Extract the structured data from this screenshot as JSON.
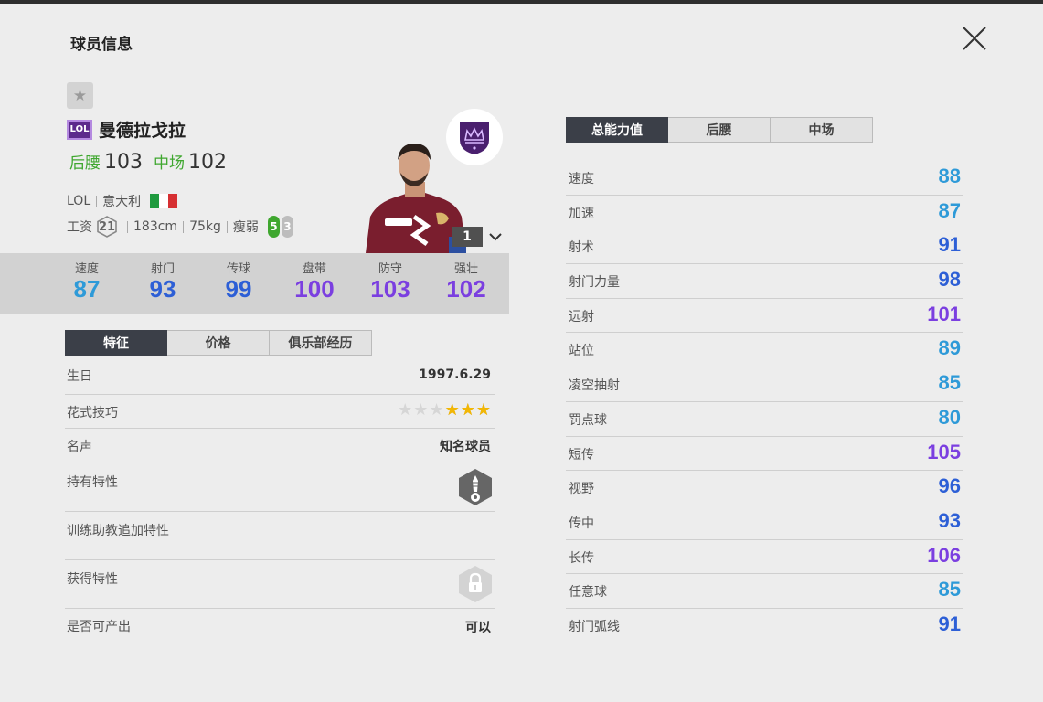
{
  "header": {
    "title": "球员信息"
  },
  "colors": {
    "green": "#3fa72f",
    "cyan": "#2e9ad8",
    "blue": "#2d5fd6",
    "purple": "#7b3fe0",
    "tabActive": "#3b3f48"
  },
  "player": {
    "season_badge": "LOL",
    "name": "曼德拉戈拉",
    "positions": [
      {
        "label": "后腰",
        "value": "103"
      },
      {
        "label": "中场",
        "value": "102"
      }
    ],
    "season": "LOL",
    "nation": "意大利",
    "salary_label": "工资",
    "salary": "21",
    "height": "183cm",
    "weight": "75kg",
    "body_type": "瘦弱",
    "left_foot": "5",
    "right_foot": "3",
    "enhance_level": "1"
  },
  "summary_stats": [
    {
      "label": "速度",
      "value": "87",
      "color": "#2e9ad8"
    },
    {
      "label": "射门",
      "value": "93",
      "color": "#2d5fd6"
    },
    {
      "label": "传球",
      "value": "99",
      "color": "#2d5fd6"
    },
    {
      "label": "盘带",
      "value": "100",
      "color": "#7b3fe0"
    },
    {
      "label": "防守",
      "value": "103",
      "color": "#7b3fe0"
    },
    {
      "label": "强壮",
      "value": "102",
      "color": "#7b3fe0"
    }
  ],
  "info_tabs": [
    "特征",
    "价格",
    "俱乐部经历"
  ],
  "info": {
    "birthday_label": "生日",
    "birthday": "1997.6.29",
    "skill_label": "花式技巧",
    "skill_stars": 3,
    "skill_stars_max": 6,
    "fame_label": "名声",
    "fame": "知名球员",
    "traits_label": "持有特性",
    "coach_traits_label": "训练助教追加特性",
    "acquired_traits_label": "获得特性",
    "tradable_label": "是否可产出",
    "tradable": "可以"
  },
  "attr_tabs": [
    "总能力值",
    "后腰",
    "中场"
  ],
  "attributes": [
    {
      "label": "速度",
      "value": "88",
      "color": "#2e9ad8"
    },
    {
      "label": "加速",
      "value": "87",
      "color": "#2e9ad8"
    },
    {
      "label": "射术",
      "value": "91",
      "color": "#2d5fd6"
    },
    {
      "label": "射门力量",
      "value": "98",
      "color": "#2d5fd6"
    },
    {
      "label": "远射",
      "value": "101",
      "color": "#7b3fe0"
    },
    {
      "label": "站位",
      "value": "89",
      "color": "#2e9ad8"
    },
    {
      "label": "凌空抽射",
      "value": "85",
      "color": "#2e9ad8"
    },
    {
      "label": "罚点球",
      "value": "80",
      "color": "#2e9ad8"
    },
    {
      "label": "短传",
      "value": "105",
      "color": "#7b3fe0"
    },
    {
      "label": "视野",
      "value": "96",
      "color": "#2d5fd6"
    },
    {
      "label": "传中",
      "value": "93",
      "color": "#2d5fd6"
    },
    {
      "label": "长传",
      "value": "106",
      "color": "#7b3fe0"
    },
    {
      "label": "任意球",
      "value": "85",
      "color": "#2e9ad8"
    },
    {
      "label": "射门弧线",
      "value": "91",
      "color": "#2d5fd6"
    }
  ]
}
